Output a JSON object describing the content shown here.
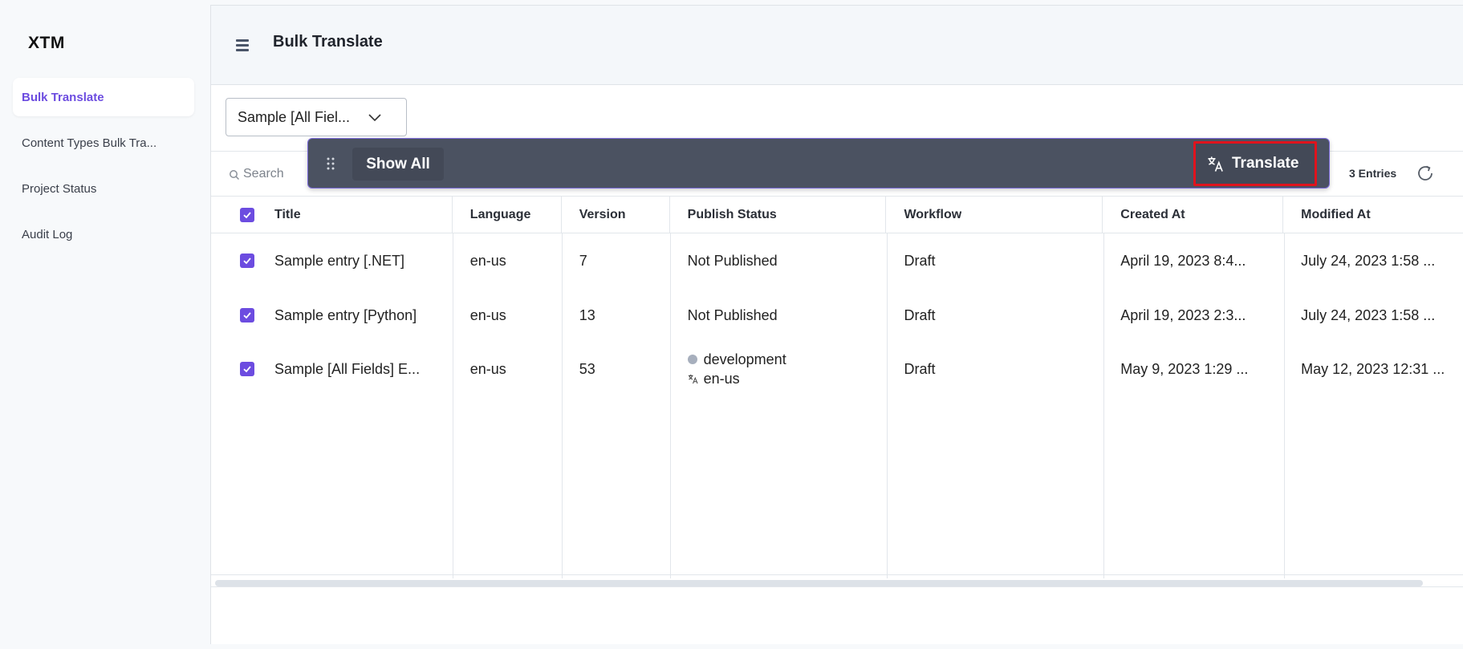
{
  "app": {
    "logo": "XTM"
  },
  "sidebar": {
    "items": [
      {
        "label": "Bulk Translate",
        "active": true
      },
      {
        "label": "Content Types Bulk Tra...",
        "active": false
      },
      {
        "label": "Project Status",
        "active": false
      },
      {
        "label": "Audit Log",
        "active": false
      }
    ]
  },
  "header": {
    "title": "Bulk Translate",
    "menu_icon": "hamburger-menu-icon"
  },
  "content_type_select": {
    "value": "Sample [All Fiel...",
    "icon": "chevron-down-icon"
  },
  "search": {
    "placeholder": "Search",
    "icon": "search-icon"
  },
  "entries": {
    "count_label": "3 Entries",
    "refresh_icon": "refresh-icon"
  },
  "action_bar": {
    "show_all_label": "Show All",
    "translate_label": "Translate",
    "drag_icon": "drag-handle-icon",
    "translate_icon": "translate-icon",
    "highlight_color": "#e0131d"
  },
  "table": {
    "columns": [
      "Title",
      "Language",
      "Version",
      "Publish Status",
      "Workflow",
      "Created At",
      "Modified At"
    ],
    "rows": [
      {
        "checked": true,
        "title": "Sample entry [.NET]",
        "language": "en-us",
        "version": "7",
        "publish_status": "Not Published",
        "workflow": "Draft",
        "created_at": "April 19, 2023 8:4...",
        "modified_at": "July 24, 2023 1:58 ..."
      },
      {
        "checked": true,
        "title": "Sample entry [Python]",
        "language": "en-us",
        "version": "13",
        "publish_status": "Not Published",
        "workflow": "Draft",
        "created_at": "April 19, 2023 2:3...",
        "modified_at": "July 24, 2023 1:58 ..."
      },
      {
        "checked": true,
        "title": "Sample [All Fields] E...",
        "language": "en-us",
        "version": "53",
        "publish_status_env": "development",
        "publish_status_locale": "en-us",
        "workflow": "Draft",
        "created_at": "May 9, 2023 1:29 ...",
        "modified_at": "May 12, 2023 12:31 ..."
      }
    ]
  },
  "colors": {
    "accent": "#6c4ce0",
    "action_bar_bg": "#4b5261"
  }
}
